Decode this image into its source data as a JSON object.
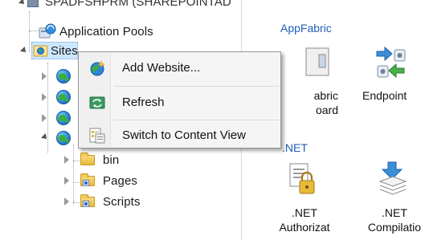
{
  "tree": {
    "server_node": "SPADFSHPRM (SHAREPOINTAD",
    "app_pools_label": "Application Pools",
    "sites_label": "Sites",
    "folders": [
      {
        "label": "bin"
      },
      {
        "label": "Pages"
      },
      {
        "label": "Scripts"
      }
    ]
  },
  "context_menu": {
    "items": [
      {
        "label": "Add Website...",
        "icon": "add-website-icon"
      },
      {
        "label": "Refresh",
        "icon": "refresh-icon"
      },
      {
        "label": "Switch to Content View",
        "icon": "content-view-icon"
      }
    ]
  },
  "features": {
    "group1_title": "AppFabric",
    "group1_items": [
      {
        "label": "abric\noard",
        "icon": "appfabric-dashboard-icon"
      },
      {
        "label": "Endpoint",
        "icon": "endpoints-icon"
      }
    ],
    "group2_title": ".NET",
    "group2_items": [
      {
        "label": ".NET\nAuthorizat",
        "icon": "net-authorization-icon"
      },
      {
        "label": ".NET\nCompilatio",
        "icon": "net-compilation-icon"
      }
    ]
  },
  "colors": {
    "accent_link": "#1f5fb8",
    "selection": "#cce8ff"
  }
}
